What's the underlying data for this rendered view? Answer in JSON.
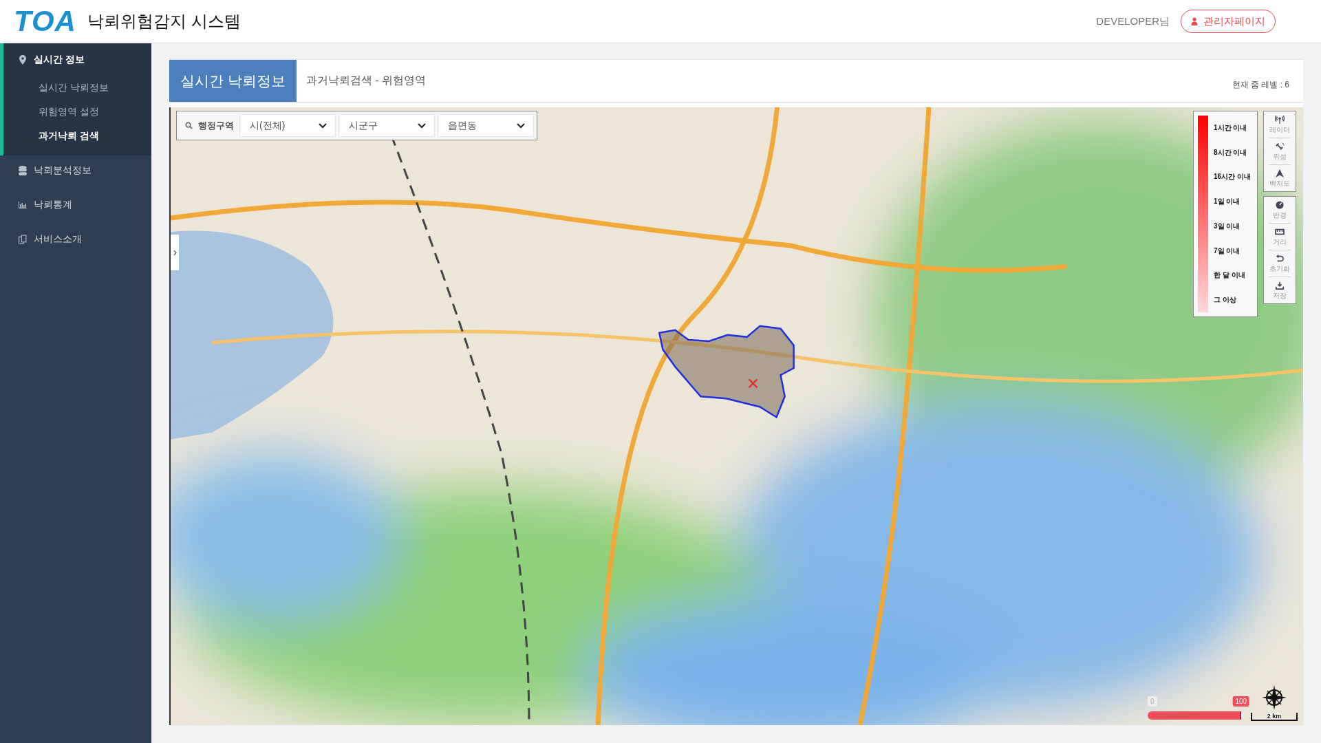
{
  "header": {
    "logo": "TOA",
    "title": "낙뢰위험감지 시스템",
    "user": "DEVELOPER님",
    "admin_button": "관리자페이지"
  },
  "sidebar": {
    "items": [
      {
        "label": "실시간 정보",
        "expanded": true,
        "children": [
          {
            "label": "실시간 낙뢰정보",
            "selected": false
          },
          {
            "label": "위험영역 설정",
            "selected": false
          },
          {
            "label": "과거낙뢰 검색",
            "selected": true
          }
        ]
      },
      {
        "label": "낙뢰분석정보",
        "expanded": false
      },
      {
        "label": "낙뢰통계",
        "expanded": false
      },
      {
        "label": "서비스소개",
        "expanded": false
      }
    ]
  },
  "panel": {
    "tab": "실시간 낙뢰정보",
    "breadcrumb": "과거낙뢰검색 - 위험영역",
    "zoom_level": "현재 줌 레벨 : 6"
  },
  "map": {
    "search": {
      "label": "행정구역",
      "selects": [
        "시(전체)",
        "시군구",
        "읍면동"
      ]
    },
    "legend": [
      "1시간 이내",
      "8시간 이내",
      "16시간 이내",
      "1일 이내",
      "3일 이내",
      "7일 이내",
      "한 달 이내",
      "그 이상"
    ],
    "tool_groups": [
      [
        "레이더",
        "위성",
        "백지도"
      ],
      [
        "반경",
        "거리",
        "초기화",
        "저장"
      ]
    ],
    "opacity_slider": {
      "min_label": "0",
      "value": "100",
      "level": 0.97
    },
    "scale": "2 km"
  }
}
